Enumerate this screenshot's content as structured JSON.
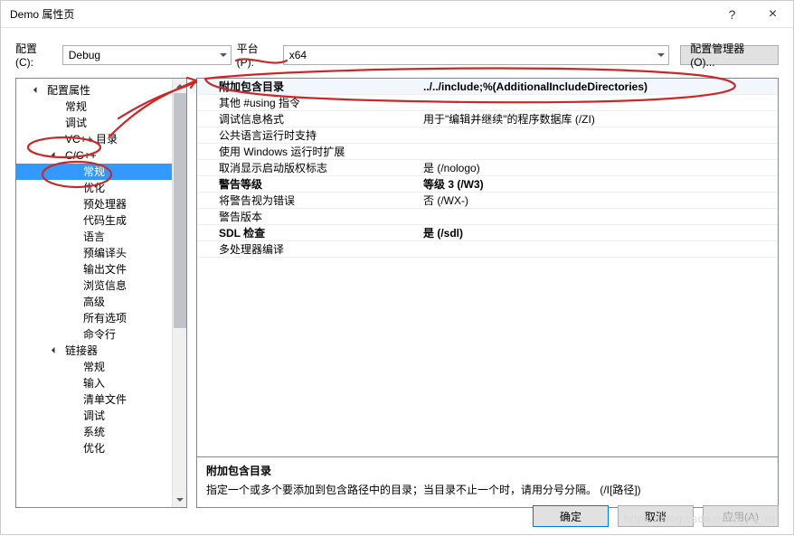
{
  "window": {
    "title": "Demo 属性页",
    "help": "?",
    "close": "×"
  },
  "config_row": {
    "config_label": "配置(C):",
    "config_value": "Debug",
    "platform_label": "平台(P):",
    "platform_value": "x64",
    "config_mgr": "配置管理器(O)..."
  },
  "tree": [
    {
      "label": "配置属性",
      "level": 0,
      "cls": "expanded"
    },
    {
      "label": "常规",
      "level": 1
    },
    {
      "label": "调试",
      "level": 1
    },
    {
      "label": "VC++ 目录",
      "level": 1
    },
    {
      "label": "C/C++",
      "level": 1,
      "cls": "expanded l1exp"
    },
    {
      "label": "常规",
      "level": 2,
      "cls": "selected"
    },
    {
      "label": "优化",
      "level": 2
    },
    {
      "label": "预处理器",
      "level": 2
    },
    {
      "label": "代码生成",
      "level": 2
    },
    {
      "label": "语言",
      "level": 2
    },
    {
      "label": "预编译头",
      "level": 2
    },
    {
      "label": "输出文件",
      "level": 2
    },
    {
      "label": "浏览信息",
      "level": 2
    },
    {
      "label": "高级",
      "level": 2
    },
    {
      "label": "所有选项",
      "level": 2
    },
    {
      "label": "命令行",
      "level": 2
    },
    {
      "label": "链接器",
      "level": 1,
      "cls": "expanded l1exp"
    },
    {
      "label": "常规",
      "level": 2
    },
    {
      "label": "输入",
      "level": 2
    },
    {
      "label": "清单文件",
      "level": 2
    },
    {
      "label": "调试",
      "level": 2
    },
    {
      "label": "系统",
      "level": 2
    },
    {
      "label": "优化",
      "level": 2
    }
  ],
  "props": [
    {
      "name": "附加包含目录",
      "val": "../../include;%(AdditionalIncludeDirectories)",
      "cls": "bold hl"
    },
    {
      "name": "其他 #using 指令",
      "val": ""
    },
    {
      "name": "调试信息格式",
      "val": "用于\"编辑并继续\"的程序数据库 (/ZI)"
    },
    {
      "name": "公共语言运行时支持",
      "val": ""
    },
    {
      "name": "使用 Windows 运行时扩展",
      "val": ""
    },
    {
      "name": "取消显示启动版权标志",
      "val": "是 (/nologo)"
    },
    {
      "name": "警告等级",
      "val": "等级 3 (/W3)",
      "cls": "bold"
    },
    {
      "name": "将警告视为错误",
      "val": "否 (/WX-)"
    },
    {
      "name": "警告版本",
      "val": ""
    },
    {
      "name": "SDL 检查",
      "val": "是 (/sdl)",
      "cls": "bold"
    },
    {
      "name": "多处理器编译",
      "val": ""
    }
  ],
  "desc": {
    "title": "附加包含目录",
    "body": "指定一个或多个要添加到包含路径中的目录；当目录不止一个时，请用分号分隔。     (/I[路径])"
  },
  "footer": {
    "ok": "确定",
    "cancel": "取消",
    "apply": "应用(A)"
  },
  "watermark": "https://blog.csdn.net/li_jia_tu"
}
